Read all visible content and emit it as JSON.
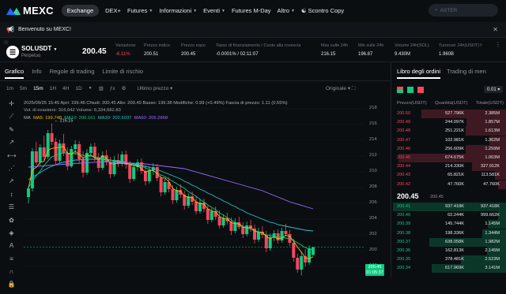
{
  "brand": {
    "name": "MEXC"
  },
  "nav": {
    "items": [
      {
        "label": "Exchange",
        "caret": false
      },
      {
        "label": "DEX+",
        "caret": false
      },
      {
        "label": "Futures",
        "caret": true
      },
      {
        "label": "Informazioni",
        "caret": true
      },
      {
        "label": "Eventi",
        "caret": true
      },
      {
        "label": "Futures M-Day",
        "caret": false
      },
      {
        "label": "Altro",
        "caret": true
      },
      {
        "label": "Scontro Copy",
        "caret": false
      }
    ]
  },
  "search": {
    "placeholder": "ASTER"
  },
  "banner": {
    "text": "Benvenuto su MEXC!"
  },
  "ticker": {
    "symbol": "SOLUSDT",
    "type": "Perpetuo",
    "price": "200.45",
    "stats": [
      {
        "label": "Variazione",
        "value": "-6.11%",
        "color": "#f6465d"
      },
      {
        "label": "Prezzo indice",
        "value": "200.51"
      },
      {
        "label": "Prezzo equo",
        "value": "200.45"
      },
      {
        "label": "Tasso di finanziamento / Conto alla rovescia",
        "value": "-0.0001% / 02:11:07"
      },
      {
        "label": "Max sulle 24h",
        "value": "216.15"
      },
      {
        "label": "Min sulle 24h",
        "value": "196.87"
      },
      {
        "label": "Volume 24h(SOL)",
        "value": "9.430M"
      },
      {
        "label": "Turnover 24h(USDT)",
        "value": "1.960B"
      }
    ]
  },
  "chart_tabs": [
    "Grafico",
    "Info",
    "Regole di trading",
    "Limite di rischio"
  ],
  "timeframes": {
    "items": [
      "1m",
      "5m",
      "15m",
      "1H",
      "4H",
      "1D"
    ],
    "active": "15m",
    "price_type": "Ultimo prezzo",
    "view": "Originale"
  },
  "ohlc": {
    "line1": "2025/09/25 15:45  Apri: 199.46  Chiudi: 200.45  Alto: 200.49  Basso: 199.38  Modifiche: 0.99 (+0.49%)  Fascia di prezzo: 1.11 (0.55%)",
    "line2": "Vol. di evasione: 316,642   Volume: 6,334,682.83"
  },
  "ma": {
    "label": "MA",
    "ma5": "MA5: 199.748",
    "ma10": "MA10: 200.161",
    "ma30": "MA30: 202.5037",
    "ma60": "MA60: 205.2868",
    "colors": {
      "ma5": "#f0b90b",
      "ma10": "#0ecb81",
      "ma30": "#2ec0c8",
      "ma60": "#9b6bff"
    }
  },
  "chart_data": {
    "type": "candlestick",
    "y_ticks": [
      "218",
      "216",
      "214",
      "212",
      "210",
      "208",
      "206",
      "204",
      "202",
      "200",
      "198"
    ],
    "ylim": [
      196.6,
      219.8
    ],
    "high_label": "216.15",
    "last_price": "200.45",
    "countdown": "01:05:37",
    "candles": [
      {
        "o": 206.8,
        "h": 208.2,
        "l": 206.0,
        "c": 207.9
      },
      {
        "o": 207.9,
        "h": 213.0,
        "l": 207.5,
        "c": 212.6
      },
      {
        "o": 212.6,
        "h": 213.8,
        "l": 210.9,
        "c": 211.2
      },
      {
        "o": 211.2,
        "h": 213.5,
        "l": 210.8,
        "c": 213.1
      },
      {
        "o": 213.1,
        "h": 214.6,
        "l": 211.5,
        "c": 211.9
      },
      {
        "o": 211.9,
        "h": 215.3,
        "l": 211.6,
        "c": 214.9
      },
      {
        "o": 214.9,
        "h": 216.15,
        "l": 213.4,
        "c": 213.8
      },
      {
        "o": 213.8,
        "h": 214.3,
        "l": 210.9,
        "c": 211.4
      },
      {
        "o": 211.4,
        "h": 214.1,
        "l": 211.1,
        "c": 213.6
      },
      {
        "o": 213.6,
        "h": 214.8,
        "l": 212.0,
        "c": 212.4
      },
      {
        "o": 212.4,
        "h": 213.1,
        "l": 210.2,
        "c": 210.7
      },
      {
        "o": 210.7,
        "h": 213.3,
        "l": 210.5,
        "c": 212.9
      },
      {
        "o": 212.9,
        "h": 214.0,
        "l": 212.2,
        "c": 213.5
      },
      {
        "o": 213.5,
        "h": 213.9,
        "l": 211.0,
        "c": 211.6
      },
      {
        "o": 211.6,
        "h": 212.6,
        "l": 209.3,
        "c": 209.9
      },
      {
        "o": 209.9,
        "h": 212.9,
        "l": 209.6,
        "c": 212.4
      },
      {
        "o": 212.4,
        "h": 213.6,
        "l": 211.9,
        "c": 213.2
      },
      {
        "o": 213.2,
        "h": 213.7,
        "l": 211.3,
        "c": 211.8
      },
      {
        "o": 211.8,
        "h": 212.4,
        "l": 210.0,
        "c": 210.5
      },
      {
        "o": 210.5,
        "h": 212.6,
        "l": 210.2,
        "c": 212.1
      },
      {
        "o": 212.1,
        "h": 212.8,
        "l": 210.8,
        "c": 211.2
      },
      {
        "o": 211.2,
        "h": 211.9,
        "l": 209.2,
        "c": 209.7
      },
      {
        "o": 209.7,
        "h": 212.0,
        "l": 209.4,
        "c": 211.5
      },
      {
        "o": 211.5,
        "h": 212.3,
        "l": 210.6,
        "c": 211.0
      },
      {
        "o": 211.0,
        "h": 212.6,
        "l": 210.7,
        "c": 212.2
      },
      {
        "o": 212.2,
        "h": 212.7,
        "l": 210.4,
        "c": 210.9
      },
      {
        "o": 210.9,
        "h": 211.4,
        "l": 208.6,
        "c": 209.1
      },
      {
        "o": 209.1,
        "h": 211.0,
        "l": 208.8,
        "c": 210.6
      },
      {
        "o": 210.6,
        "h": 211.6,
        "l": 210.1,
        "c": 211.2
      },
      {
        "o": 211.2,
        "h": 211.7,
        "l": 209.7,
        "c": 210.1
      },
      {
        "o": 210.1,
        "h": 210.8,
        "l": 208.3,
        "c": 208.8
      },
      {
        "o": 208.8,
        "h": 210.7,
        "l": 208.5,
        "c": 210.2
      },
      {
        "o": 210.2,
        "h": 211.1,
        "l": 209.6,
        "c": 210.6
      },
      {
        "o": 210.6,
        "h": 211.0,
        "l": 208.8,
        "c": 209.2
      },
      {
        "o": 209.2,
        "h": 209.6,
        "l": 206.9,
        "c": 207.4
      },
      {
        "o": 207.4,
        "h": 209.1,
        "l": 207.1,
        "c": 208.7
      },
      {
        "o": 208.7,
        "h": 209.3,
        "l": 207.4,
        "c": 207.8
      },
      {
        "o": 207.8,
        "h": 208.3,
        "l": 205.9,
        "c": 206.4
      },
      {
        "o": 206.4,
        "h": 208.1,
        "l": 206.1,
        "c": 207.7
      },
      {
        "o": 207.7,
        "h": 208.4,
        "l": 206.7,
        "c": 207.1
      },
      {
        "o": 207.1,
        "h": 207.6,
        "l": 205.2,
        "c": 205.7
      },
      {
        "o": 205.7,
        "h": 207.3,
        "l": 205.4,
        "c": 206.9
      },
      {
        "o": 206.9,
        "h": 207.5,
        "l": 205.8,
        "c": 206.2
      },
      {
        "o": 206.2,
        "h": 206.9,
        "l": 204.6,
        "c": 205.0
      },
      {
        "o": 205.0,
        "h": 206.5,
        "l": 204.7,
        "c": 206.1
      },
      {
        "o": 206.1,
        "h": 206.6,
        "l": 204.9,
        "c": 205.3
      },
      {
        "o": 205.3,
        "h": 205.7,
        "l": 203.4,
        "c": 203.9
      },
      {
        "o": 203.9,
        "h": 205.4,
        "l": 203.6,
        "c": 205.0
      },
      {
        "o": 205.0,
        "h": 205.6,
        "l": 203.9,
        "c": 204.3
      },
      {
        "o": 204.3,
        "h": 205.1,
        "l": 202.8,
        "c": 203.2
      },
      {
        "o": 203.2,
        "h": 204.6,
        "l": 202.9,
        "c": 204.1
      },
      {
        "o": 204.1,
        "h": 204.8,
        "l": 203.3,
        "c": 203.7
      },
      {
        "o": 203.7,
        "h": 204.2,
        "l": 202.0,
        "c": 202.5
      },
      {
        "o": 202.5,
        "h": 204.1,
        "l": 202.2,
        "c": 203.6
      },
      {
        "o": 203.6,
        "h": 204.3,
        "l": 202.7,
        "c": 203.0
      },
      {
        "o": 203.0,
        "h": 203.6,
        "l": 201.6,
        "c": 202.1
      },
      {
        "o": 202.1,
        "h": 203.7,
        "l": 201.8,
        "c": 203.2
      },
      {
        "o": 203.2,
        "h": 203.9,
        "l": 202.4,
        "c": 202.8
      },
      {
        "o": 202.8,
        "h": 203.3,
        "l": 200.9,
        "c": 201.4
      },
      {
        "o": 201.4,
        "h": 202.9,
        "l": 201.1,
        "c": 202.4
      },
      {
        "o": 202.4,
        "h": 203.1,
        "l": 201.6,
        "c": 202.0
      },
      {
        "o": 202.0,
        "h": 202.5,
        "l": 199.8,
        "c": 200.3
      },
      {
        "o": 200.3,
        "h": 202.2,
        "l": 200.0,
        "c": 201.7
      },
      {
        "o": 201.7,
        "h": 202.6,
        "l": 201.2,
        "c": 202.2
      },
      {
        "o": 202.2,
        "h": 202.7,
        "l": 200.9,
        "c": 201.3
      },
      {
        "o": 201.3,
        "h": 202.9,
        "l": 201.0,
        "c": 202.5
      },
      {
        "o": 202.5,
        "h": 203.4,
        "l": 201.8,
        "c": 202.1
      },
      {
        "o": 202.1,
        "h": 202.6,
        "l": 200.6,
        "c": 201.0
      },
      {
        "o": 201.0,
        "h": 201.5,
        "l": 198.6,
        "c": 199.1
      },
      {
        "o": 199.1,
        "h": 199.6,
        "l": 197.2,
        "c": 197.6
      },
      {
        "o": 197.6,
        "h": 199.8,
        "l": 196.87,
        "c": 199.3
      },
      {
        "o": 199.3,
        "h": 200.2,
        "l": 198.0,
        "c": 198.5
      },
      {
        "o": 198.5,
        "h": 200.7,
        "l": 198.2,
        "c": 200.3
      },
      {
        "o": 199.46,
        "h": 200.49,
        "l": 199.38,
        "c": 200.45
      }
    ],
    "ma_series": {
      "ma10": [
        208.0,
        208.8,
        209.5,
        210.1,
        210.8,
        211.4,
        211.9,
        212.1,
        212.3,
        212.4,
        212.4,
        212.3,
        212.3,
        212.2,
        212.1,
        212.0,
        212.0,
        211.9,
        211.8,
        211.7,
        211.6,
        211.5,
        211.4,
        211.3,
        211.2,
        211.1,
        211.0,
        210.9,
        210.8,
        210.7,
        210.5,
        210.3,
        210.1,
        209.9,
        209.6,
        209.4,
        209.1,
        208.8,
        208.5,
        208.2,
        207.9,
        207.5,
        207.2,
        206.9,
        206.5,
        206.2,
        205.8,
        205.5,
        205.2,
        204.8,
        204.5,
        204.2,
        203.9,
        203.6,
        203.4,
        203.1,
        202.9,
        202.7,
        202.5,
        202.3,
        202.2,
        202.0,
        201.9,
        201.8,
        201.7,
        201.7,
        201.6,
        201.5,
        201.3,
        201.0,
        200.7,
        200.4,
        200.2,
        200.16
      ],
      "ma30": [
        209.0,
        209.3,
        209.6,
        209.9,
        210.2,
        210.5,
        210.7,
        210.9,
        211.1,
        211.2,
        211.3,
        211.4,
        211.5,
        211.5,
        211.6,
        211.6,
        211.6,
        211.6,
        211.6,
        211.6,
        211.5,
        211.5,
        211.4,
        211.4,
        211.3,
        211.2,
        211.1,
        211.0,
        210.9,
        210.8,
        210.7,
        210.6,
        210.4,
        210.3,
        210.1,
        209.9,
        209.7,
        209.5,
        209.3,
        209.1,
        208.8,
        208.6,
        208.3,
        208.1,
        207.8,
        207.6,
        207.3,
        207.1,
        206.8,
        206.6,
        206.3,
        206.1,
        205.8,
        205.6,
        205.3,
        205.1,
        204.8,
        204.6,
        204.4,
        204.2,
        204.0,
        203.8,
        203.6,
        203.5,
        203.3,
        203.2,
        203.1,
        203.0,
        202.9,
        202.8,
        202.7,
        202.6,
        202.55,
        202.5
      ]
    },
    "ma60_points": [
      [
        0,
        210.6
      ],
      [
        10,
        211.0
      ],
      [
        20,
        211.3
      ],
      [
        30,
        211.0
      ],
      [
        40,
        210.4
      ],
      [
        50,
        209.0
      ],
      [
        60,
        207.6
      ],
      [
        67,
        206.2
      ],
      [
        73,
        205.3
      ]
    ]
  },
  "orderbook": {
    "tabs": [
      "Libro degli ordini",
      "Trading di mercato"
    ],
    "precision": "0.01",
    "headers": [
      "Prezzo(USDT)",
      "Quantità(USDT)",
      "Totale(USDT)"
    ],
    "asks": [
      {
        "price": "200.50",
        "qty": "527.796K",
        "total": "2.385M",
        "depth": 0.75
      },
      {
        "price": "200.49",
        "qty": "244.097K",
        "total": "1.857M",
        "depth": 0.35
      },
      {
        "price": "200.48",
        "qty": "251.221K",
        "total": "1.613M",
        "depth": 0.36
      },
      {
        "price": "200.47",
        "qty": "102.981K",
        "total": "1.362M",
        "depth": 0.15
      },
      {
        "price": "200.46",
        "qty": "256.609K",
        "total": "1.259M",
        "depth": 0.36
      },
      {
        "price": "200.45",
        "qty": "674.675K",
        "total": "1.003M",
        "depth": 0.95
      },
      {
        "price": "200.44",
        "qty": "214.330K",
        "total": "327.912K",
        "depth": 0.3
      },
      {
        "price": "200.43",
        "qty": "65.821K",
        "total": "113.581K",
        "depth": 0.1
      },
      {
        "price": "200.42",
        "qty": "47.760K",
        "total": "47.760K",
        "depth": 0.07
      }
    ],
    "mid_price": "200.45",
    "mid_sub": "200.45",
    "bids": [
      {
        "price": "200.41",
        "qty": "937.418K",
        "total": "937.418K",
        "depth": 1.0
      },
      {
        "price": "200.40",
        "qty": "62.244K",
        "total": "999.662K",
        "depth": 0.07
      },
      {
        "price": "200.39",
        "qty": "145.744K",
        "total": "1.145M",
        "depth": 0.16
      },
      {
        "price": "200.38",
        "qty": "198.336K",
        "total": "1.344M",
        "depth": 0.21
      },
      {
        "price": "200.37",
        "qty": "638.058K",
        "total": "1.982M",
        "depth": 0.68
      },
      {
        "price": "200.36",
        "qty": "162.813K",
        "total": "2.145M",
        "depth": 0.17
      },
      {
        "price": "200.35",
        "qty": "378.481K",
        "total": "2.523M",
        "depth": 0.4
      },
      {
        "price": "200.34",
        "qty": "617.969K",
        "total": "3.141M",
        "depth": 0.66
      }
    ]
  }
}
